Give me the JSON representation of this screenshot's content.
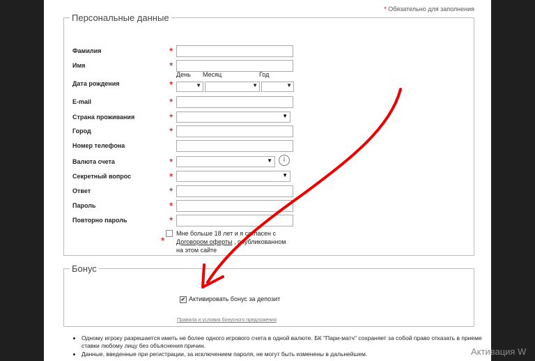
{
  "required_note": "Обязательно для заполнения",
  "required_star": "*",
  "personal": {
    "legend": "Персональные данные",
    "fields": {
      "surname": "Фамилия",
      "name": "Имя",
      "birthdate": "Дата рождения",
      "email": "E-mail",
      "country": "Страна проживания",
      "city": "Город",
      "phone": "Номер телефона",
      "currency": "Валюта счета",
      "secret_question": "Секретный вопрос",
      "answer": "Ответ",
      "password": "Пароль",
      "password_repeat": "Повторно пароль"
    },
    "date_heads": {
      "day": "День",
      "month": "Месяц",
      "year": "Год"
    },
    "agree": {
      "text_before": "Мне больше 18 лет и я согласен с",
      "link": "Договором оферты",
      "text_after": ", опубликованном на этом сайте"
    }
  },
  "bonus": {
    "legend": "Бонус",
    "checkbox_label": "Активировать бонус за депозит",
    "checkbox_checked": true,
    "terms_link": "Правила и условия бонусного предложения"
  },
  "notes": [
    "Одному игроку разрешается иметь не более одного игрового счета в одной валюте. БК \"Пари-матч\" сохраняет за собой право отказать в приеме ставки любому лицу без объяснения причин.",
    "Данные, введенные при регистрации, за исключением пароля, не могут быть изменены в дальнейшем."
  ],
  "watermark": "Активация W",
  "icons": {
    "dropdown": "▼",
    "info": "i",
    "check": "✔"
  },
  "colors": {
    "required": "#dd0000",
    "arrow": "#ee0000",
    "backdrop": "#1f1f1f"
  }
}
